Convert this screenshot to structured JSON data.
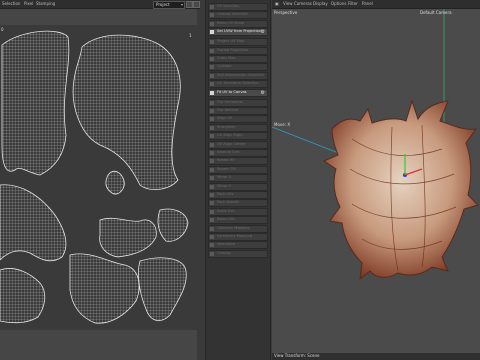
{
  "uv_editor": {
    "menu": [
      "Selection",
      "Pixel",
      "Stamping"
    ],
    "dropdown_value": "Project",
    "marker_left": "0",
    "marker_right": "1"
  },
  "palette": {
    "items": [
      {
        "label": "Fill Selection",
        "state": "disabled"
      },
      {
        "label": "Unwrap Selected",
        "state": "disabled"
      },
      {
        "label": "Relax UV Scale",
        "state": "disabled"
      },
      {
        "label": "Set UVW from Projection",
        "state": "active"
      },
      {
        "label": "Project UV Map",
        "state": "disabled"
      },
      {
        "label": "Frontal Projection",
        "state": "disabled"
      },
      {
        "label": "Cubic Map",
        "state": "disabled"
      },
      {
        "label": "Cylinder",
        "state": "disabled"
      },
      {
        "label": "Self-Intersection Selection",
        "state": "disabled"
      },
      {
        "label": "UV Transform Selection",
        "state": "disabled"
      },
      {
        "label": "Fit UV to Canvas",
        "state": "active"
      },
      {
        "label": "Flip Horizontal",
        "state": "disabled"
      },
      {
        "label": "Flip Vertical",
        "state": "disabled"
      },
      {
        "label": "Align UV",
        "state": "disabled"
      },
      {
        "label": "Straighten",
        "state": "disabled"
      },
      {
        "label": "UV Align Right",
        "state": "disabled"
      },
      {
        "label": "UV Align Center",
        "state": "disabled"
      },
      {
        "label": "Align to Grid",
        "state": "disabled"
      },
      {
        "label": "Rotate 90",
        "state": "disabled"
      },
      {
        "label": "Rotate CW",
        "state": "disabled"
      },
      {
        "label": "Mirror U",
        "state": "disabled"
      },
      {
        "label": "Mirror V",
        "state": "disabled"
      },
      {
        "label": "Pack UVs",
        "state": "disabled"
      },
      {
        "label": "Pack Islands",
        "state": "disabled"
      },
      {
        "label": "Scale UVs",
        "state": "disabled"
      },
      {
        "label": "Relax UVs",
        "state": "disabled"
      },
      {
        "label": "Optimize Mapping",
        "state": "disabled"
      },
      {
        "label": "Symmetry Mapping",
        "state": "disabled"
      },
      {
        "label": "Normalize",
        "state": "disabled"
      },
      {
        "label": "Unwrap",
        "state": "disabled"
      }
    ]
  },
  "viewport": {
    "menu": [
      "View",
      "Cameras",
      "Display",
      "Options",
      "Filter",
      "Panel"
    ],
    "perspective_label": "Perspective",
    "camera_label": "Default Camera",
    "axis_label": "Move: X",
    "status_text": "View Transform: Scene"
  },
  "colors": {
    "accent": "#d8d8d8",
    "shell_base": "#c8a890",
    "shell_dark": "#8a3a20"
  }
}
